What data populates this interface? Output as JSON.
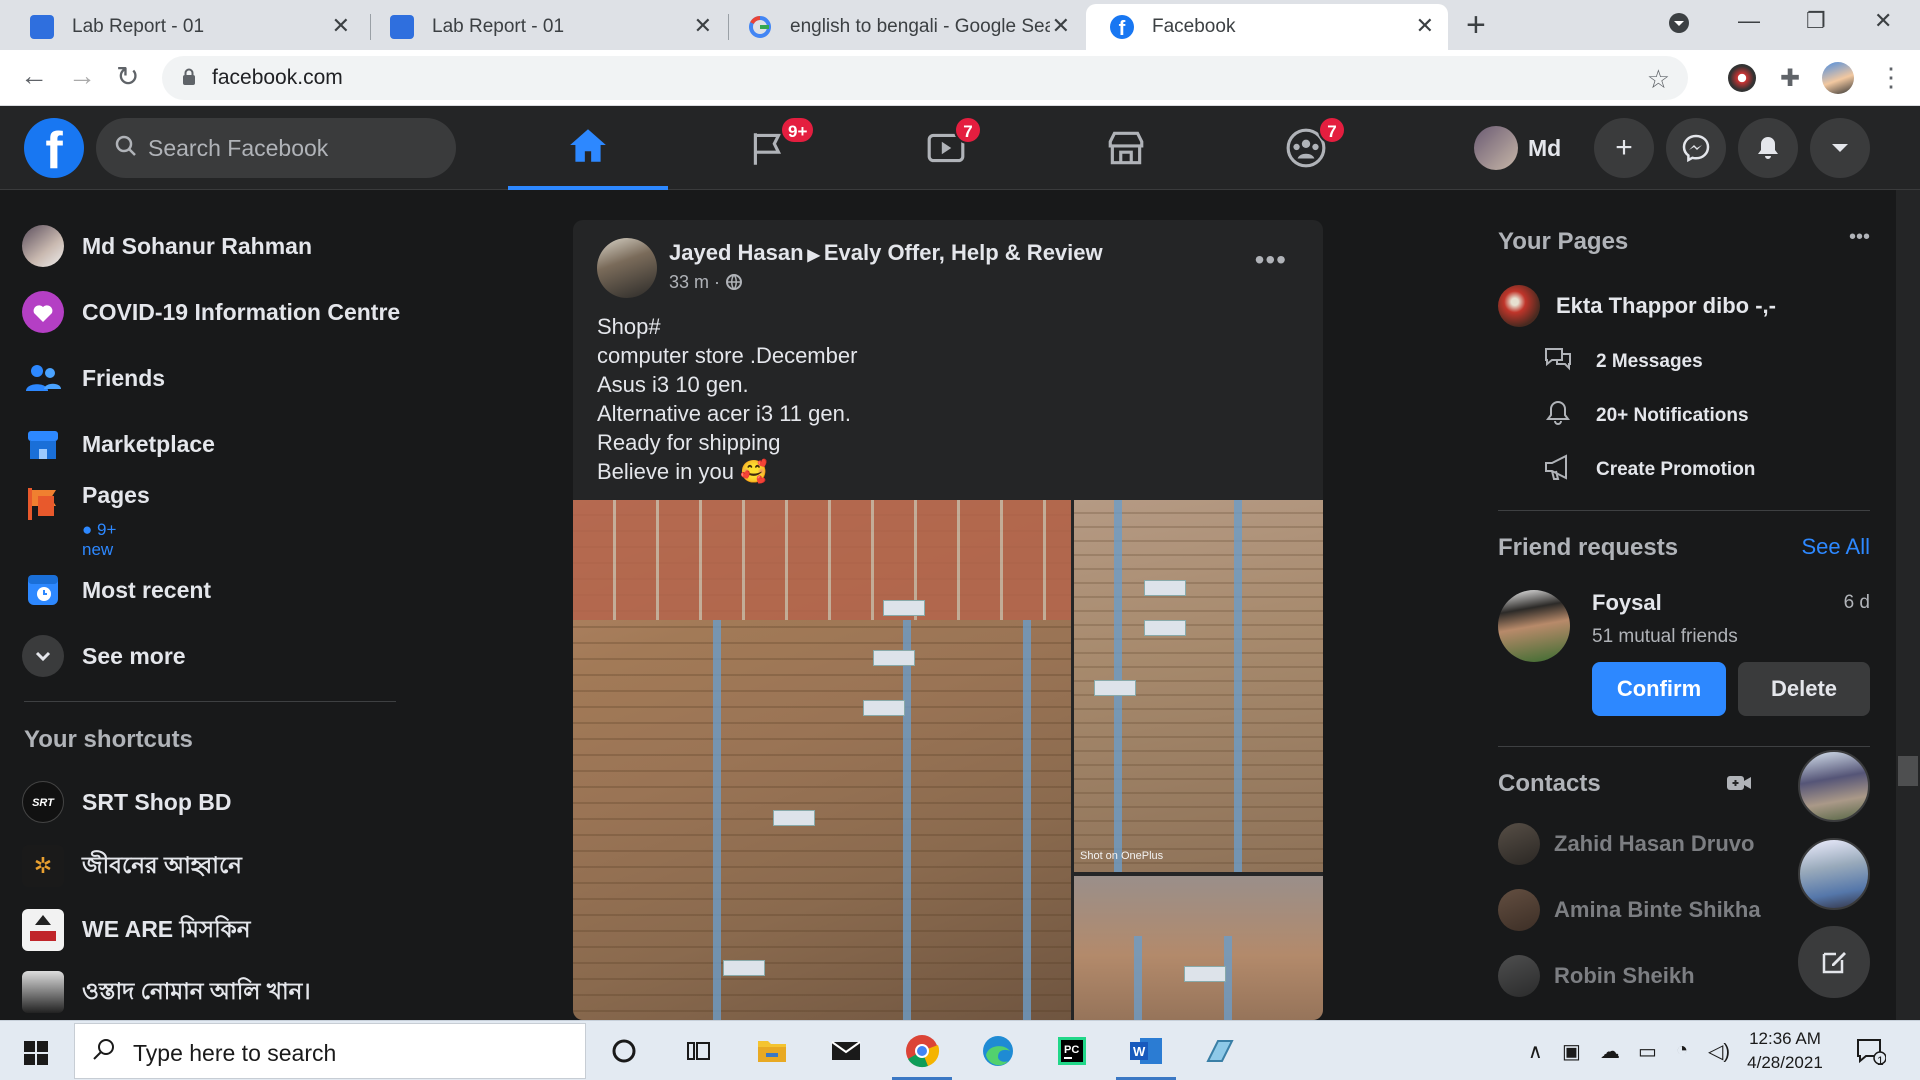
{
  "browser": {
    "tabs": [
      {
        "title": "Lab Report - 01",
        "icon": "google-classroom-icon",
        "active": false
      },
      {
        "title": "Lab Report - 01",
        "icon": "google-classroom-icon",
        "active": false
      },
      {
        "title": "english to bengali - Google Searc",
        "icon": "google-icon",
        "active": false
      },
      {
        "title": "Facebook",
        "icon": "facebook-icon",
        "active": true
      }
    ],
    "url": "facebook.com"
  },
  "fb": {
    "search_placeholder": "Search Facebook",
    "badges": {
      "pages": "9+",
      "watch": "7",
      "groups": "7"
    },
    "profile_name": "Md",
    "accent": "#2d88ff",
    "badge_color": "#e41e3f"
  },
  "left": {
    "items": [
      {
        "label": "Md Sohanur Rahman"
      },
      {
        "label": "COVID-19 Information Centre"
      },
      {
        "label": "Friends"
      },
      {
        "label": "Marketplace"
      },
      {
        "label": "Pages",
        "sub": "9+ new"
      },
      {
        "label": "Most recent"
      },
      {
        "label": "See more"
      }
    ],
    "shortcuts_heading": "Your shortcuts",
    "shortcuts": [
      {
        "label": "SRT Shop BD"
      },
      {
        "label": "জীবনের আহ্বানে"
      },
      {
        "label": "WE ARE মিসকিন"
      },
      {
        "label": "ওস্তাদ নোমান আলি খান।"
      }
    ]
  },
  "post": {
    "author": "Jayed Hasan",
    "group": "Evaly Offer, Help & Review",
    "time": "33 m ·",
    "lines": [
      "Shop#",
      "computer store .December",
      "Asus i3 10 gen.",
      "Alternative acer i3 11 gen.",
      "Ready for shipping",
      "Believe in you 🥰"
    ],
    "watermark": "Shot on OnePlus"
  },
  "right": {
    "your_pages_heading": "Your Pages",
    "page_name": "Ekta Thappor dibo -,-",
    "page_actions": [
      {
        "label": "2 Messages",
        "icon": "chat-bubbles-icon"
      },
      {
        "label": "20+ Notifications",
        "icon": "bell-icon"
      },
      {
        "label": "Create Promotion",
        "icon": "megaphone-icon"
      }
    ],
    "friend_requests_heading": "Friend requests",
    "see_all": "See All",
    "request": {
      "name": "Foysal",
      "age": "6 d",
      "mutual": "51 mutual friends",
      "confirm": "Confirm",
      "delete": "Delete"
    },
    "contacts_heading": "Contacts",
    "contacts": [
      {
        "name": "Zahid Hasan Druvo"
      },
      {
        "name": "Amina Binte Shikha"
      },
      {
        "name": "Robin Sheikh"
      }
    ]
  },
  "taskbar": {
    "search_placeholder": "Type here to search",
    "time": "12:36 AM",
    "date": "4/28/2021",
    "notifications": "1"
  }
}
